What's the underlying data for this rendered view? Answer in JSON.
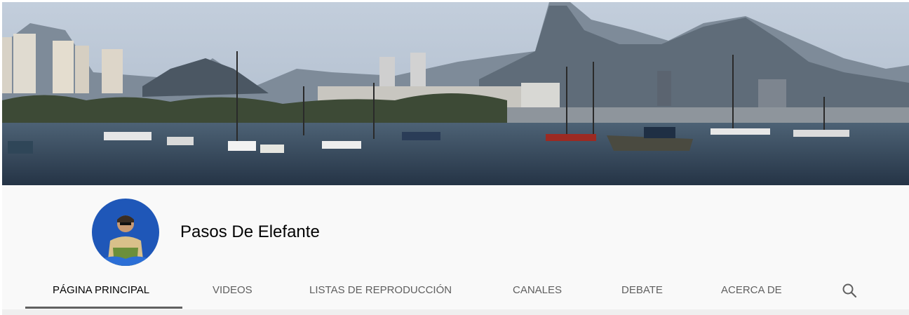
{
  "channel": {
    "name": "Pasos De Elefante"
  },
  "tabs": [
    {
      "label": "PÁGINA PRINCIPAL",
      "active": true
    },
    {
      "label": "VIDEOS",
      "active": false
    },
    {
      "label": "LISTAS DE REPRODUCCIÓN",
      "active": false
    },
    {
      "label": "CANALES",
      "active": false
    },
    {
      "label": "DEBATE",
      "active": false
    },
    {
      "label": "ACERCA DE",
      "active": false
    }
  ],
  "icons": {
    "search": "search-icon"
  },
  "colors": {
    "header_bg": "#f9f9f9",
    "tab_text": "#606060",
    "tab_active_text": "#030303",
    "tab_underline": "#606060"
  }
}
